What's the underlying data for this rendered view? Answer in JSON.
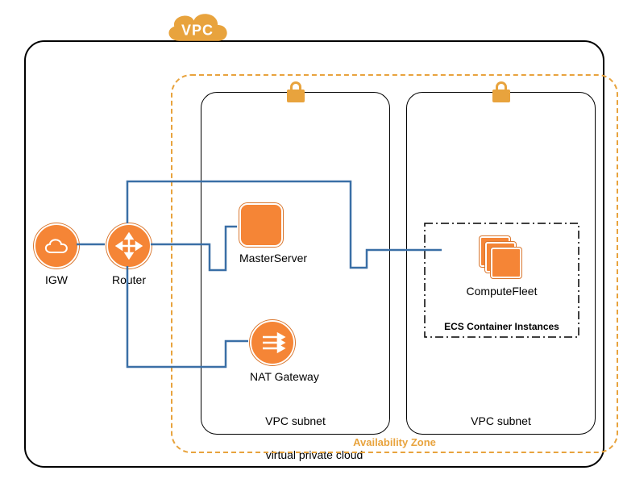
{
  "cloud_label": "VPC",
  "vpc_label": "virtual private cloud",
  "availability_zone_label": "Availability Zone",
  "subnets": {
    "left_label": "VPC subnet",
    "right_label": "VPC subnet"
  },
  "nodes": {
    "igw": "IGW",
    "router": "Router",
    "master": "MasterServer",
    "nat": "NAT Gateway",
    "compute_fleet": "ComputeFleet"
  },
  "ecs_box_label": "ECS Container Instances",
  "colors": {
    "orange": "#F58536",
    "az_orange": "#E8A33D",
    "wire_blue": "#3A6FA6"
  }
}
